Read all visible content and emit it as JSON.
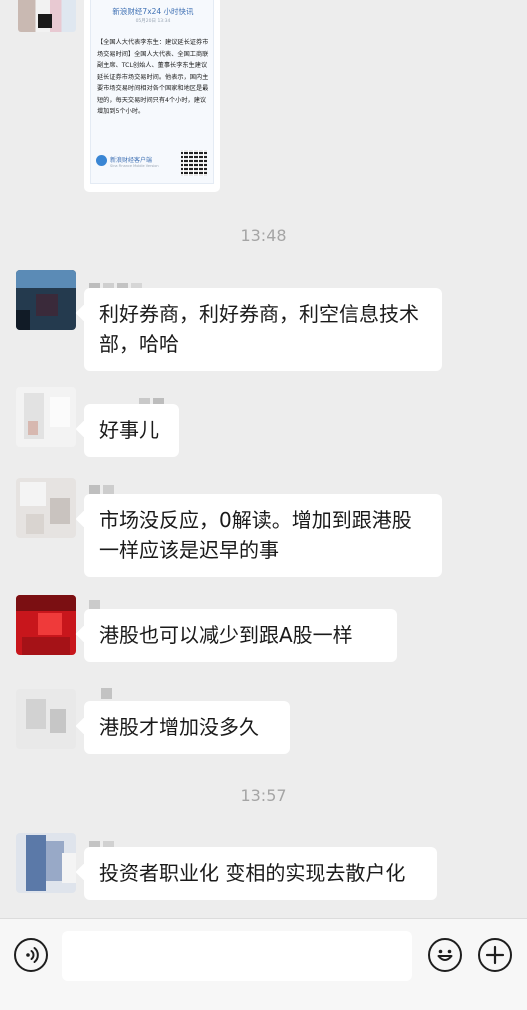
{
  "card": {
    "title": "新浪财经7x24 小时快讯",
    "date": "05月20日 13:34",
    "body": "【全国人大代表李东生：建议延长证券市场交易时间】全国人大代表、全国工商联副主席、TCL创始人、董事长李东生建议延长证券市场交易时间。他表示，国内主要市场交易时间相对各个国家和地区是最短的，每天交易时间只有4个小时，建议增加到5个小时。",
    "logo_name": "新浪财经客户端",
    "logo_sub": "Sina Finance Mobile Version"
  },
  "times": [
    "13:48",
    "13:57"
  ],
  "messages": [
    {
      "text": "利好券商，利好券商，利空信息技术部，哈哈"
    },
    {
      "text": "好事儿"
    },
    {
      "text": " 市场没反应，0解读。增加到跟港股一样应该是迟早的事"
    },
    {
      "text": "港股也可以减少到跟A股一样"
    },
    {
      "text": "港股才增加没多久"
    },
    {
      "text": "投资者职业化  变相的实现去散户化"
    }
  ],
  "input": {
    "value": ""
  },
  "icons": [
    "voice-icon",
    "emoji-icon",
    "plus-icon"
  ]
}
